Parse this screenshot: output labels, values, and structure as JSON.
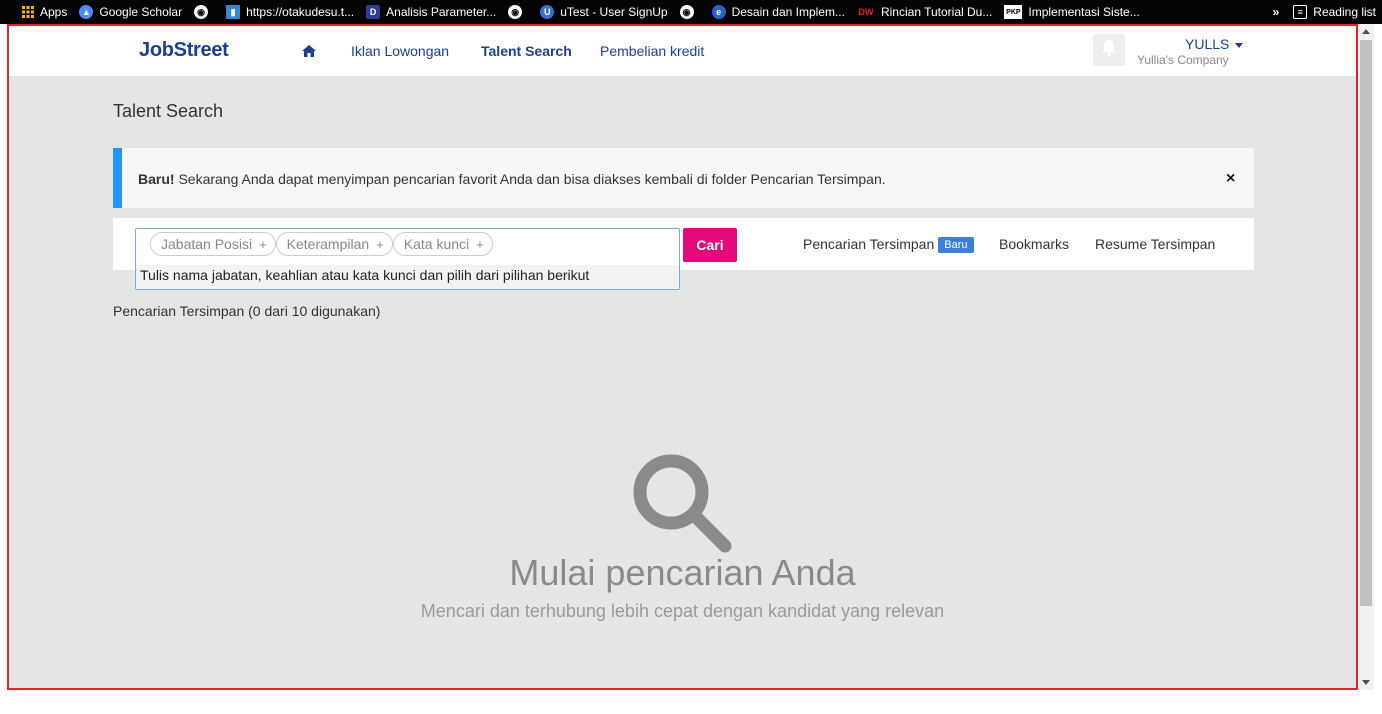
{
  "bookmarks": {
    "items": [
      {
        "label": "Apps",
        "icon": "apps-grid-icon"
      },
      {
        "label": "Google Scholar",
        "icon": "graduation-cap-icon"
      },
      {
        "label": "",
        "icon": "globe-icon"
      },
      {
        "label": "https://otakudesu.t...",
        "icon": "page-icon"
      },
      {
        "label": "Analisis Parameter...",
        "icon": "d-logo-icon"
      },
      {
        "label": "",
        "icon": "globe-icon"
      },
      {
        "label": "uTest - User SignUp",
        "icon": "utest-logo-icon"
      },
      {
        "label": "",
        "icon": "globe-icon"
      },
      {
        "label": "Desain dan Implem...",
        "icon": "e-logo-icon"
      },
      {
        "label": "Rincian Tutorial Du...",
        "icon": "dw-logo-icon"
      },
      {
        "label": "Implementasi Siste...",
        "icon": "pkp-logo-icon"
      }
    ],
    "more": "»",
    "reading_list": "Reading list"
  },
  "nav": {
    "logo": "JobStreet",
    "links": [
      "Iklan Lowongan",
      "Talent Search",
      "Pembelian kredit"
    ],
    "active": "Talent Search",
    "user_name": "YULLS",
    "company": "Yullia's Company"
  },
  "page": {
    "title": "Talent Search"
  },
  "alert": {
    "bold": "Baru!",
    "text": " Sekarang Anda dapat menyimpan pencarian favorit Anda dan bisa diakses kembali di folder Pencarian Tersimpan.",
    "close": "×"
  },
  "search": {
    "chips": [
      "Jabatan Posisi",
      "Keterampilan",
      "Kata kunci"
    ],
    "chip_plus": "+",
    "hint": "Tulis nama jabatan, keahlian atau kata kunci dan pilih dari pilihan berikut",
    "button": "Cari",
    "saved_searches": "Pencarian Tersimpan",
    "badge": "Baru",
    "bookmarks": "Bookmarks",
    "saved_resumes": "Resume Tersimpan"
  },
  "saved_count": "Pencarian Tersimpan (0 dari 10 digunakan)",
  "empty_state": {
    "title": "Mulai pencarian Anda",
    "subtitle": "Mencari dan terhubung lebih cepat dengan kandidat yang relevan"
  },
  "colors": {
    "brand": "#1c3f94",
    "accent": "#e3097b",
    "alert_bar": "#2196f3",
    "badge": "#3d7fd8",
    "frame_border": "#e0242a"
  }
}
